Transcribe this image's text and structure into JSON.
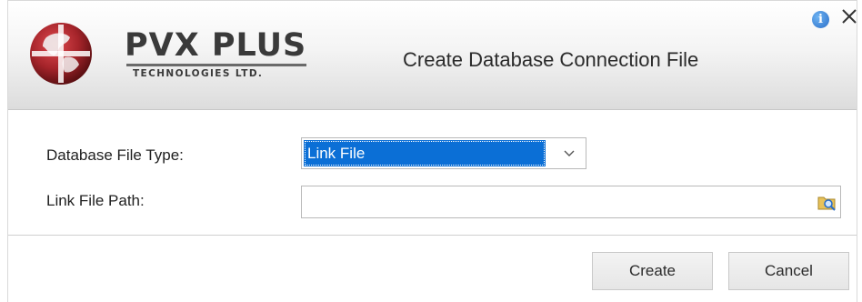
{
  "brand": {
    "name": "PVX PLUS",
    "subtitle": "TECHNOLOGIES LTD."
  },
  "dialog": {
    "title": "Create Database Connection File"
  },
  "form": {
    "file_type_label": "Database File Type:",
    "file_type_value": "Link File",
    "path_label": "Link File Path:",
    "path_value": ""
  },
  "buttons": {
    "create": "Create",
    "cancel": "Cancel"
  },
  "icons": {
    "info": "info-icon",
    "close": "close-icon",
    "dropdown": "chevron-down-icon",
    "browse": "folder-search-icon"
  },
  "colors": {
    "selection": "#0b6fd6",
    "info": "#2a6ec9",
    "logo_red": "#b3262b"
  }
}
